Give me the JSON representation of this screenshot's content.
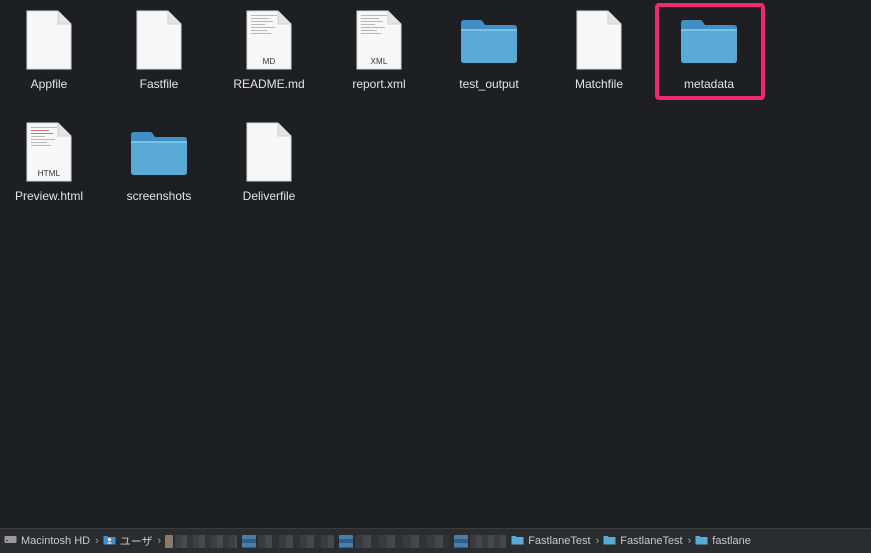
{
  "window": {
    "background": "#1e1f23"
  },
  "files": [
    {
      "name": "Appfile",
      "kind": "document",
      "tag": ""
    },
    {
      "name": "Fastfile",
      "kind": "document",
      "tag": ""
    },
    {
      "name": "README.md",
      "kind": "document-preview",
      "tag": "MD"
    },
    {
      "name": "report.xml",
      "kind": "document-preview",
      "tag": "XML"
    },
    {
      "name": "test_output",
      "kind": "folder",
      "tag": ""
    },
    {
      "name": "Matchfile",
      "kind": "document",
      "tag": ""
    },
    {
      "name": "metadata",
      "kind": "folder",
      "tag": "",
      "highlighted": true
    },
    {
      "name": "Preview.html",
      "kind": "document-preview",
      "tag": "HTML"
    },
    {
      "name": "screenshots",
      "kind": "folder",
      "tag": ""
    },
    {
      "name": "Deliverfile",
      "kind": "document",
      "tag": ""
    }
  ],
  "highlight_color": "#f0286c",
  "folder_color": "#5aaad8",
  "pathbar": {
    "items": [
      {
        "label": "Macintosh HD",
        "icon": "hard-drive-icon"
      },
      {
        "label": "ユーザ",
        "icon": "users-folder-icon"
      },
      {
        "label": "",
        "icon": "redacted"
      },
      {
        "label": "",
        "icon": "redacted"
      },
      {
        "label": "",
        "icon": "redacted"
      },
      {
        "label": "",
        "icon": "redacted"
      },
      {
        "label": "FastlaneTest",
        "icon": "folder-icon"
      },
      {
        "label": "FastlaneTest",
        "icon": "folder-icon"
      },
      {
        "label": "fastlane",
        "icon": "folder-icon"
      }
    ]
  }
}
